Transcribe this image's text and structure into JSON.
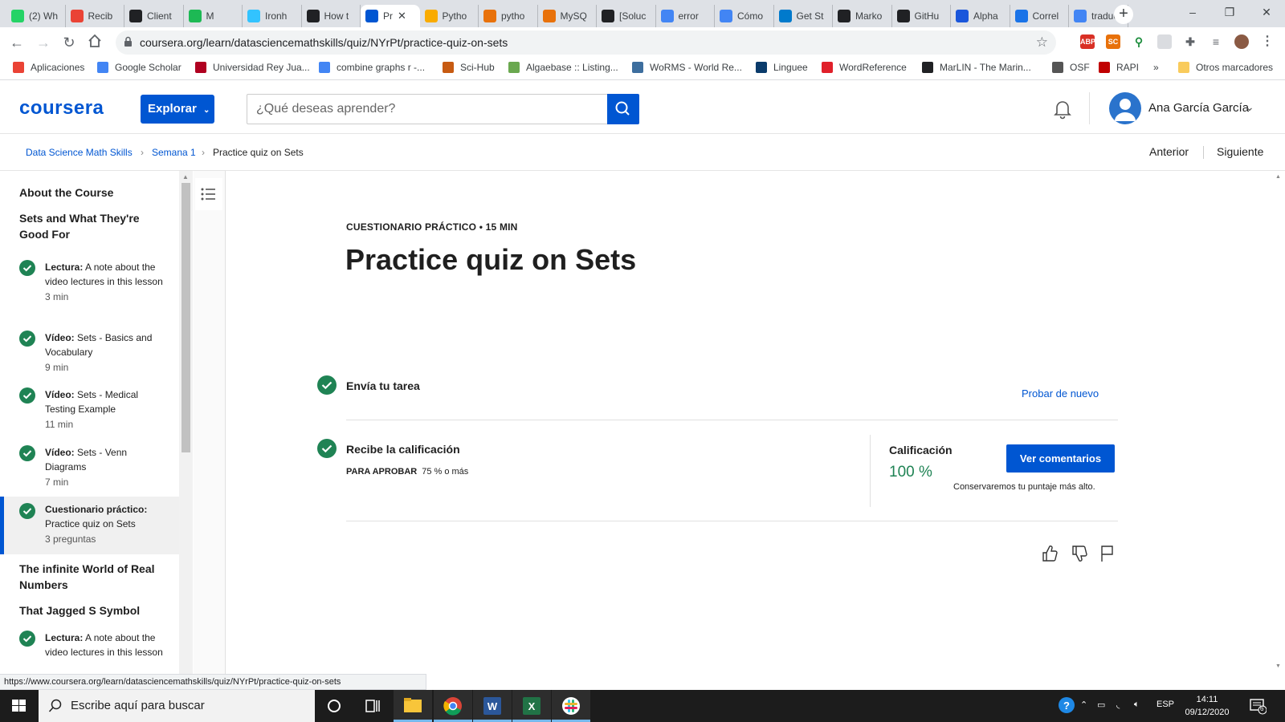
{
  "browser": {
    "tabs": [
      {
        "label": "(2) Wh",
        "icon": "whatsapp-icon",
        "color": "#25d366"
      },
      {
        "label": "Recib",
        "icon": "gmail-icon",
        "color": "#ea4335"
      },
      {
        "label": "Client",
        "icon": "client-icon",
        "color": "#202124"
      },
      {
        "label": "M",
        "icon": "audio-tab-icon",
        "color": "#1db954"
      },
      {
        "label": "Ironh",
        "icon": "ironhack-icon",
        "color": "#32c3ff"
      },
      {
        "label": "How t",
        "icon": "hexagon-icon",
        "color": "#202124"
      },
      {
        "label": "Pr",
        "icon": "coursera-icon",
        "color": "#0056d2",
        "active": true
      },
      {
        "label": "Pytho",
        "icon": "colab-icon",
        "color": "#f9ab00"
      },
      {
        "label": "pytho",
        "icon": "pen-icon",
        "color": "#e8710a"
      },
      {
        "label": "MySQ",
        "icon": "pen-icon",
        "color": "#e8710a"
      },
      {
        "label": "[Soluc",
        "icon": "solution-icon",
        "color": "#202124"
      },
      {
        "label": "error",
        "icon": "google-icon",
        "color": "#4285f4"
      },
      {
        "label": "Cómo",
        "icon": "cómo-icon",
        "color": "#4285f4"
      },
      {
        "label": "Get St",
        "icon": "vscode-icon",
        "color": "#007acc"
      },
      {
        "label": "Marko",
        "icon": "markdown-icon",
        "color": "#202124"
      },
      {
        "label": "GitHu",
        "icon": "github-icon",
        "color": "#202124"
      },
      {
        "label": "Alpha",
        "icon": "alpha-icon",
        "color": "#1a56db"
      },
      {
        "label": "Correl",
        "icon": "letter-a-icon",
        "color": "#1a73e8"
      },
      {
        "label": "traduc",
        "icon": "google-icon",
        "color": "#4285f4"
      }
    ],
    "url": "coursera.org/learn/datasciencemathskills/quiz/NYrPt/practice-quiz-on-sets",
    "bookmarks": [
      {
        "label": "Aplicaciones",
        "icon": "apps-grid-icon",
        "color": "#ea4335"
      },
      {
        "label": "Google Scholar",
        "icon": "scholar-icon",
        "color": "#4285f4"
      },
      {
        "label": "Universidad Rey Jua...",
        "icon": "university-icon",
        "color": "#b00020"
      },
      {
        "label": "combine graphs r -...",
        "icon": "google-icon",
        "color": "#4285f4"
      },
      {
        "label": "Sci-Hub",
        "icon": "scihub-icon",
        "color": "#c75b12"
      },
      {
        "label": "Algaebase :: Listing...",
        "icon": "algaebase-icon",
        "color": "#6aa84f"
      },
      {
        "label": "WoRMS - World Re...",
        "icon": "worms-icon",
        "color": "#3d6e9e"
      },
      {
        "label": "Linguee",
        "icon": "linguee-icon",
        "color": "#0a3b6b"
      },
      {
        "label": "WordReference",
        "icon": "wordreference-icon",
        "color": "#e0202a"
      },
      {
        "label": "MarLIN - The Marin...",
        "icon": "marlin-icon",
        "color": "#202124"
      },
      {
        "label": "OSF",
        "icon": "osf-icon",
        "color": "#555555"
      },
      {
        "label": "RAPI",
        "icon": "rapi-icon",
        "color": "#c00000"
      }
    ],
    "bookmarks_more": "»",
    "other_bookmarks": "Otros marcadores",
    "status_url": "https://www.coursera.org/learn/datasciencemathskills/quiz/NYrPt/practice-quiz-on-sets"
  },
  "header": {
    "logo": "coursera",
    "explore_label": "Explorar",
    "search_placeholder": "¿Qué deseas aprender?",
    "user_name": "Ana García García"
  },
  "breadcrumb": {
    "course": "Data Science Math Skills",
    "week": "Semana 1",
    "current": "Practice quiz on Sets",
    "prev": "Anterior",
    "next": "Siguiente"
  },
  "sidebar": {
    "sections": [
      {
        "title": "About the Course"
      },
      {
        "title": "Sets and What They're Good For"
      },
      {
        "title": "The infinite World of Real Numbers"
      },
      {
        "title": "That Jagged S Symbol"
      }
    ],
    "items": [
      {
        "type": "Lectura:",
        "text": "A note about the video lectures in this lesson",
        "meta": "3 min"
      },
      {
        "type": "Vídeo:",
        "text": "Sets - Basics and Vocabulary",
        "meta": "9 min"
      },
      {
        "type": "Vídeo:",
        "text": "Sets - Medical Testing Example",
        "meta": "11 min"
      },
      {
        "type": "Vídeo:",
        "text": "Sets - Venn Diagrams",
        "meta": "7 min"
      },
      {
        "type": "Cuestionario práctico:",
        "text": "Practice quiz on Sets",
        "meta": "3 preguntas"
      },
      {
        "type": "Lectura:",
        "text": "A note about the video lectures in this lesson",
        "meta": ""
      }
    ]
  },
  "main": {
    "overline": "CUESTIONARIO PRÁCTICO • 15 MIN",
    "title": "Practice quiz on Sets",
    "step1_title": "Envía tu tarea",
    "retry_label": "Probar de nuevo",
    "step2_title": "Recibe la calificación",
    "pass_label": "PARA APROBAR",
    "pass_value": "75 % o más",
    "grade_label": "Calificación",
    "grade_value": "100 %",
    "view_feedback": "Ver comentarios",
    "keep_note": "Conservaremos tu puntaje más alto."
  },
  "taskbar": {
    "search_placeholder": "Escribe aquí para buscar",
    "lang": "ESP",
    "time": "14:11",
    "date": "09/12/2020",
    "notif_count": "6"
  },
  "colors": {
    "brand": "#0056d2",
    "success": "#1f8354"
  }
}
